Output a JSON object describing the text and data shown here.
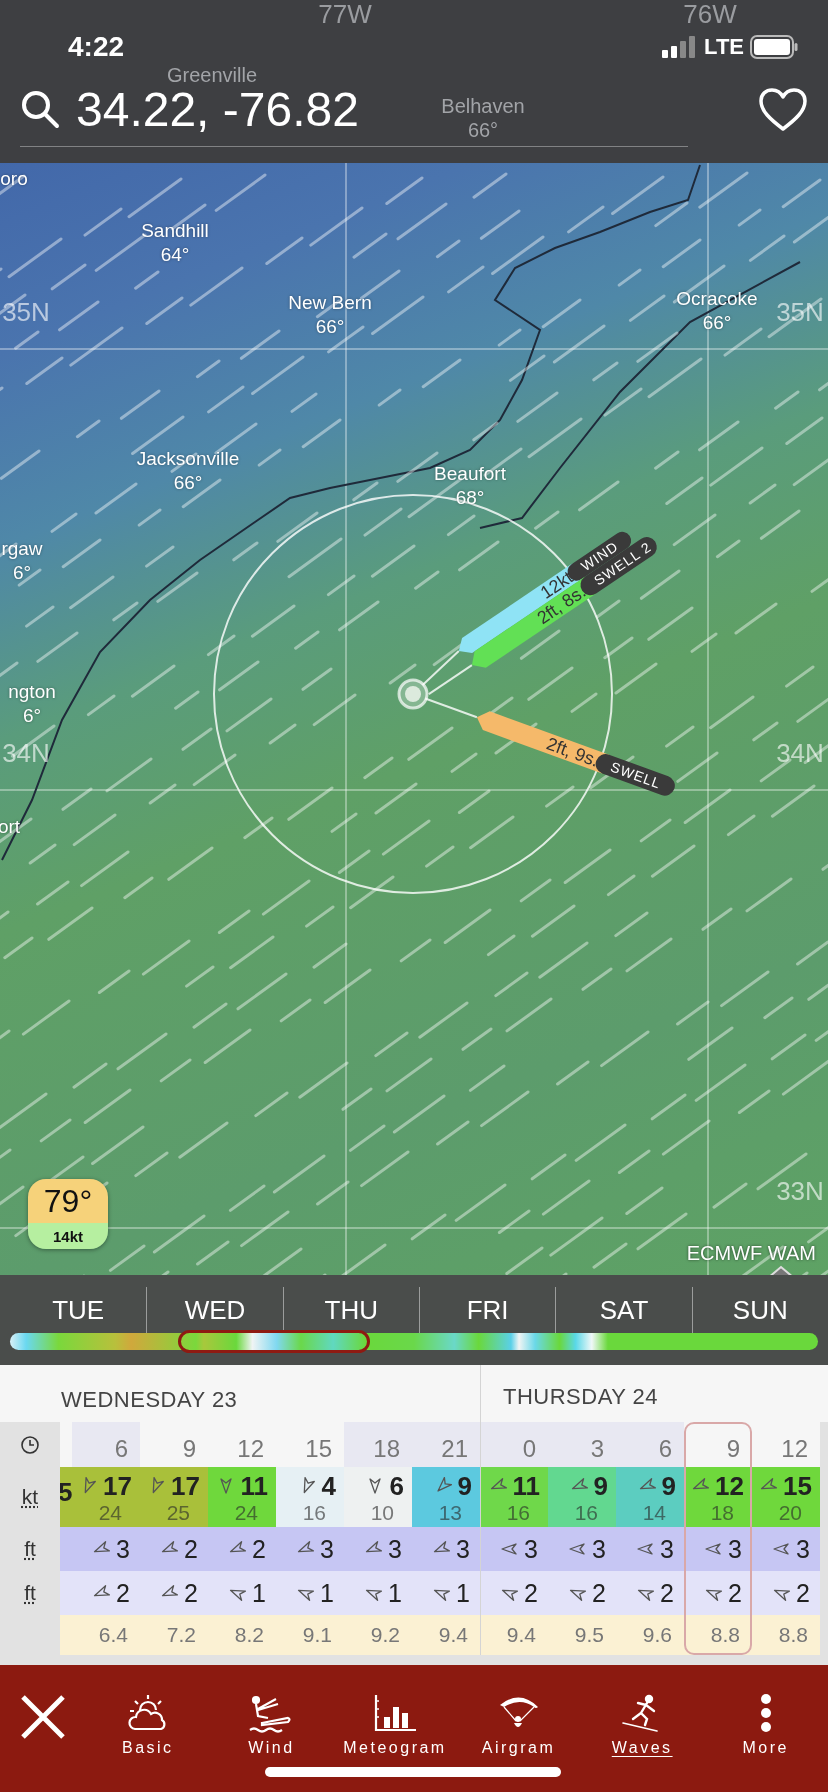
{
  "status_bar": {
    "time": "4:22",
    "network": "LTE"
  },
  "search": {
    "value": "34.22, -76.82"
  },
  "map": {
    "grid_labels": [
      "77W",
      "76W",
      "35N",
      "35N",
      "34N",
      "34N",
      "33N"
    ],
    "places": [
      {
        "name": "Greenville"
      },
      {
        "name": "Belhaven",
        "temp": "66°"
      },
      {
        "name": "oro"
      },
      {
        "name": "Sandhill",
        "temp": "64°"
      },
      {
        "name": "New Bern",
        "temp": "66°"
      },
      {
        "name": "Ocracoke",
        "temp": "66°"
      },
      {
        "name": "Jacksonville",
        "temp": "66°"
      },
      {
        "name": "Beaufort",
        "temp": "68°"
      },
      {
        "name": "rgaw",
        "temp": "6°"
      },
      {
        "name": "ngton",
        "temp": "6°"
      },
      {
        "name": "ort"
      }
    ],
    "pointers": [
      {
        "kind": "wind",
        "label": "WIND",
        "value": "12kt",
        "color": "#8fe3f5"
      },
      {
        "kind": "swell2",
        "label": "SWELL 2",
        "value": "2ft, 8s.",
        "color": "#62e055"
      },
      {
        "kind": "swell",
        "label": "SWELL",
        "value": "2ft, 9s.",
        "color": "#f5b96a"
      }
    ],
    "badge": {
      "temp": "79°",
      "wind": "14kt"
    },
    "model": "ECMWF WAM"
  },
  "timeline": {
    "days": [
      "TUE",
      "WED",
      "THU",
      "FRI",
      "SAT",
      "SUN"
    ]
  },
  "table": {
    "row_labels": [
      "kt",
      "ft",
      "ft"
    ],
    "kt_fragment": "5",
    "days": [
      {
        "label": "WEDNESDAY 23",
        "columns": [
          {
            "time": "6",
            "night": true,
            "wind": "17",
            "gust": "24",
            "color": "#a9c03a",
            "swell": "3",
            "swell2": "2",
            "period": "6.4",
            "selected": false
          },
          {
            "time": "9",
            "night": false,
            "wind": "17",
            "gust": "25",
            "color": "#a9c03a",
            "swell": "2",
            "swell2": "2",
            "period": "7.2",
            "selected": false
          },
          {
            "time": "12",
            "night": false,
            "wind": "11",
            "gust": "24",
            "color": "#6fd83c",
            "swell": "2",
            "swell2": "1",
            "period": "8.2",
            "selected": false
          },
          {
            "time": "15",
            "night": false,
            "wind": "4",
            "gust": "16",
            "color": "#e6f0f4",
            "swell": "3",
            "swell2": "1",
            "period": "9.1",
            "selected": false
          },
          {
            "time": "18",
            "night": true,
            "wind": "6",
            "gust": "10",
            "color": "#eef1f1",
            "swell": "3",
            "swell2": "1",
            "period": "9.2",
            "selected": false
          },
          {
            "time": "21",
            "night": true,
            "wind": "9",
            "gust": "13",
            "color": "#5cc9df",
            "swell": "3",
            "swell2": "1",
            "period": "9.4",
            "selected": false
          }
        ]
      },
      {
        "label": "THURSDAY 24",
        "columns": [
          {
            "time": "0",
            "night": true,
            "wind": "11",
            "gust": "16",
            "color": "#6fd84a",
            "swell": "3",
            "swell2": "2",
            "period": "9.4",
            "selected": false
          },
          {
            "time": "3",
            "night": true,
            "wind": "9",
            "gust": "16",
            "color": "#62d890",
            "swell": "3",
            "swell2": "2",
            "period": "9.5",
            "selected": false
          },
          {
            "time": "6",
            "night": true,
            "wind": "9",
            "gust": "14",
            "color": "#5ccdc0",
            "swell": "3",
            "swell2": "2",
            "period": "9.6",
            "selected": false
          },
          {
            "time": "9",
            "night": false,
            "wind": "12",
            "gust": "18",
            "color": "#6fd83c",
            "swell": "3",
            "swell2": "2",
            "period": "8.8",
            "selected": true
          },
          {
            "time": "12",
            "night": false,
            "wind": "15",
            "gust": "20",
            "color": "#6fd83c",
            "swell": "3",
            "swell2": "2",
            "period": "8.8",
            "selected": false
          }
        ]
      }
    ]
  },
  "nav": {
    "items": [
      {
        "kind": "basic",
        "label": "Basic",
        "selected": false
      },
      {
        "kind": "wind",
        "label": "Wind",
        "selected": false
      },
      {
        "kind": "meteogram",
        "label": "Meteogram",
        "selected": false
      },
      {
        "kind": "airgram",
        "label": "Airgram",
        "selected": false
      },
      {
        "kind": "waves",
        "label": "Waves",
        "selected": true
      },
      {
        "kind": "more",
        "label": "More",
        "selected": false
      }
    ]
  }
}
